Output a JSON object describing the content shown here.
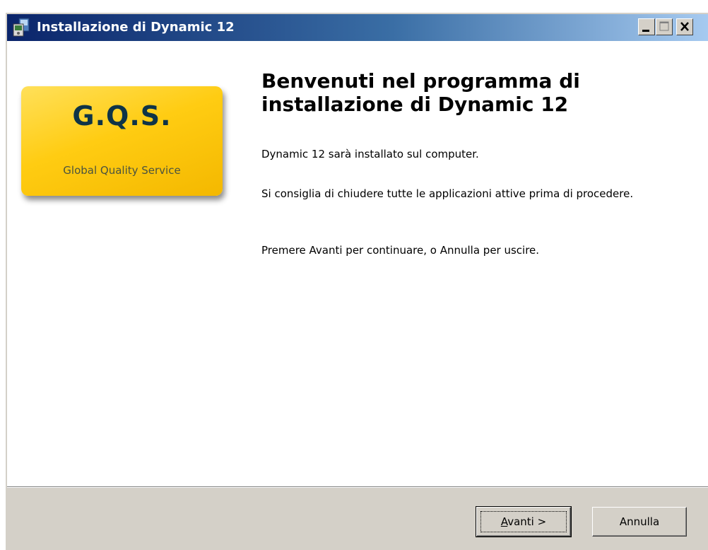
{
  "window": {
    "title": "Installazione di Dynamic 12",
    "icon": "installer-app-icon",
    "caption_buttons": [
      "minimize-icon",
      "maximize-icon",
      "close-icon"
    ]
  },
  "logo": {
    "title": "G.Q.S.",
    "subtitle": "Global Quality Service",
    "colors": {
      "background": "#ffcc12",
      "title": "#0f3447"
    }
  },
  "main": {
    "heading": "Benvenuti nel programma di installazione di Dynamic 12",
    "paragraphs": [
      "Dynamic 12 sarà installato sul computer.",
      "Si consiglia di chiudere tutte le applicazioni attive prima di procedere.",
      "Premere Avanti per continuare, o Annulla per uscire."
    ]
  },
  "buttons": {
    "next": {
      "accelerator": "A",
      "rest": "vanti >"
    },
    "cancel": "Annulla"
  }
}
